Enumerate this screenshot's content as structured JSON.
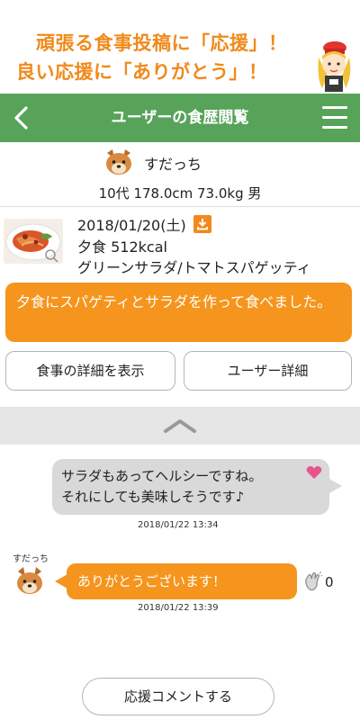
{
  "banner": {
    "line1": "頑張る食事投稿に「応援」！",
    "line2": "良い応援に「ありがとう」！"
  },
  "header": {
    "title": "ユーザーの食歴閲覧",
    "back_icon": "chevron-left-icon",
    "menu_icon": "hamburger-menu-icon"
  },
  "user": {
    "name": "すだっち",
    "stats": "10代 178.0cm 73.0kg 男"
  },
  "meal": {
    "date": "2018/01/20(土)",
    "kcal": "夕食 512kcal",
    "items": "グリーンサラダ/トマトスパゲッティ",
    "comment": "夕食にスパゲティとサラダを作って食べました。"
  },
  "buttons": {
    "meal_detail": "食事の詳細を表示",
    "user_detail": "ユーザー詳細",
    "support_comment": "応援コメントする"
  },
  "chat": {
    "message1": {
      "text_line1": "サラダもあってヘルシーですね。",
      "text_line2": "それにしても美味しそうです♪",
      "time": "2018/01/22 13:34"
    },
    "reply": {
      "user": "すだっち",
      "text": "ありがとうございます！",
      "clap_count": "0",
      "time": "2018/01/22 13:39"
    }
  },
  "colors": {
    "header_green": "#57a35a",
    "accent_orange": "#f5951d",
    "banner_orange": "#f08a1c",
    "heart_pink": "#e8548a"
  }
}
